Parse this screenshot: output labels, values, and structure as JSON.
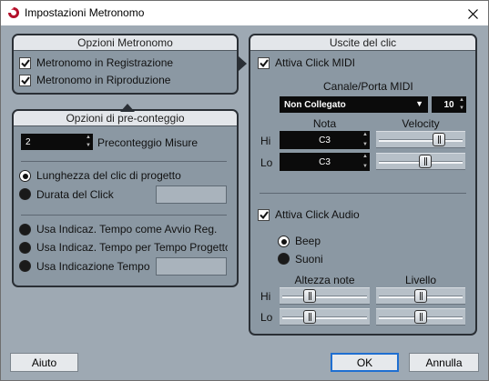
{
  "window": {
    "title": "Impostazioni Metronomo",
    "icon": "cubase-logo-icon",
    "close_glyph": "✕"
  },
  "metronome_options": {
    "header": "Opzioni Metronomo",
    "record_label": "Metronomo in Registrazione",
    "record_checked": true,
    "playback_label": "Metronomo in Riproduzione",
    "playback_checked": true
  },
  "precount": {
    "header": "Opzioni di pre-conteggio",
    "bars_value": "2",
    "bars_label": "Preconteggio Misure",
    "project_click_length_label": "Lunghezza del clic di progetto",
    "click_duration_label": "Durata del Click",
    "selected_duration_option": "project_click_length",
    "tempo_start_label": "Usa Indicaz. Tempo come Avvio Reg.",
    "tempo_project_label": "Usa Indicaz. Tempo per Tempo Progetto",
    "tempo_use_label": "Usa Indicazione Tempo",
    "selected_tempo_option": "none"
  },
  "click_outputs": {
    "header": "Uscite del clic",
    "midi_click_label": "Attiva Click MIDI",
    "midi_click_checked": true,
    "channel_port_label": "Canale/Porta MIDI",
    "port_value": "Non Collegato",
    "channel_value": "10",
    "note_label": "Nota",
    "velocity_label": "Velocity",
    "hi_label": "Hi",
    "lo_label": "Lo",
    "hi_note": "C3",
    "lo_note": "C3",
    "hi_velocity_fraction": 0.74,
    "lo_velocity_fraction": 0.56,
    "audio_click_label": "Attiva Click Audio",
    "audio_click_checked": true,
    "beep_label": "Beep",
    "sounds_label": "Suoni",
    "selected_sound": "beep",
    "pitch_label": "Altezza note",
    "level_label": "Livello",
    "hi_pitch_fraction": 0.3,
    "lo_pitch_fraction": 0.3,
    "hi_level_fraction": 0.5,
    "lo_level_fraction": 0.5
  },
  "footer": {
    "help_label": "Aiuto",
    "ok_label": "OK",
    "cancel_label": "Annulla"
  },
  "colors": {
    "dialog_background": "#9ea9b3",
    "panel_background": "#8b98a3",
    "panel_header": "#e3e6ea",
    "default_button_border": "#1f6fd1"
  }
}
